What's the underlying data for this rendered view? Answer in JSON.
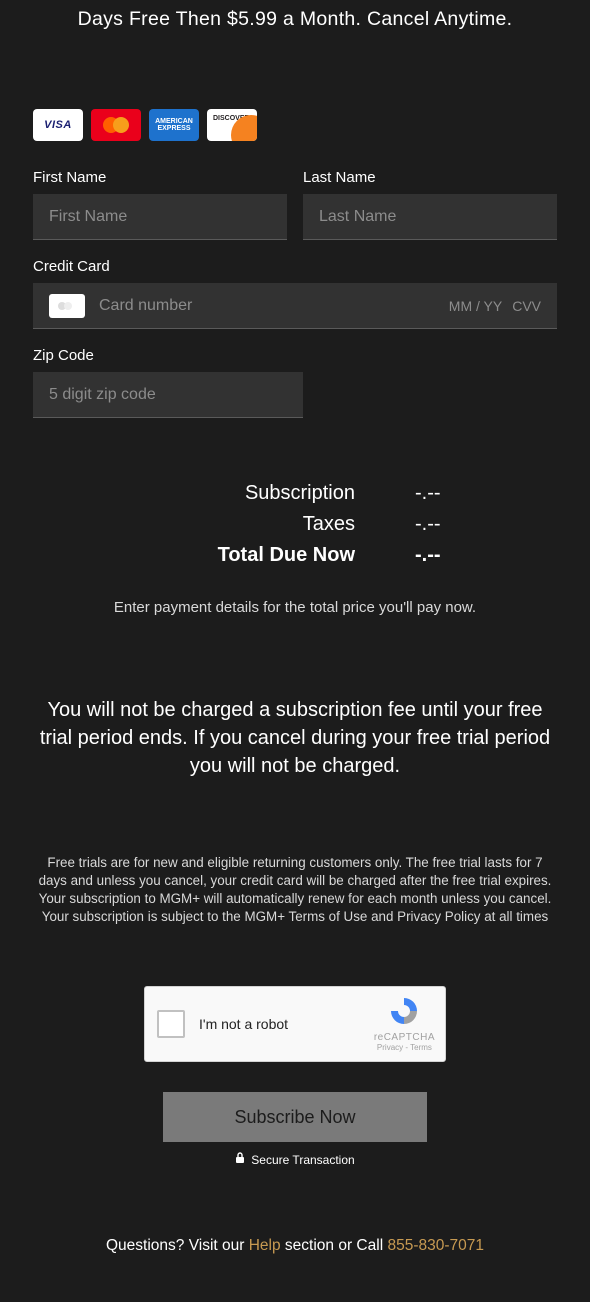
{
  "headline": "Days Free Then $5.99 a Month. Cancel Anytime.",
  "card_icons": {
    "visa": "VISA",
    "amex_l1": "AMERICAN",
    "amex_l2": "EXPRESS",
    "discover": "DISCOVER"
  },
  "form": {
    "first_name_label": "First Name",
    "first_name_placeholder": "First Name",
    "last_name_label": "Last Name",
    "last_name_placeholder": "Last Name",
    "cc_label": "Credit Card",
    "cc_placeholder": "Card number",
    "cc_expiry": "MM / YY",
    "cc_cvv": "CVV",
    "zip_label": "Zip Code",
    "zip_placeholder": "5 digit zip code"
  },
  "summary": {
    "subscription_label": "Subscription",
    "subscription_value": "-.--",
    "taxes_label": "Taxes",
    "taxes_value": "-.--",
    "total_label": "Total Due Now",
    "total_value": "-.--",
    "note": "Enter payment details for the total price you'll pay now."
  },
  "trial_text": "You will not be charged a subscription fee until your free trial period ends. If you cancel during your free trial period you will not be charged.",
  "legal": "Free trials are for new and eligible returning customers only. The free trial lasts for 7 days and unless you cancel, your credit card will be charged after the free trial expires. Your subscription to MGM+ will automatically renew for each month unless you cancel. Your subscription is subject to the MGM+ Terms of Use and Privacy Policy at all times",
  "recaptcha": {
    "label": "I'm not a robot",
    "brand": "reCAPTCHA",
    "links": "Privacy - Terms"
  },
  "subscribe_label": "Subscribe Now",
  "secure_label": "Secure Transaction",
  "footer": {
    "q1": "Questions? Visit our ",
    "help": "Help",
    "q2": " section or Call ",
    "phone": "855-830-7071"
  }
}
